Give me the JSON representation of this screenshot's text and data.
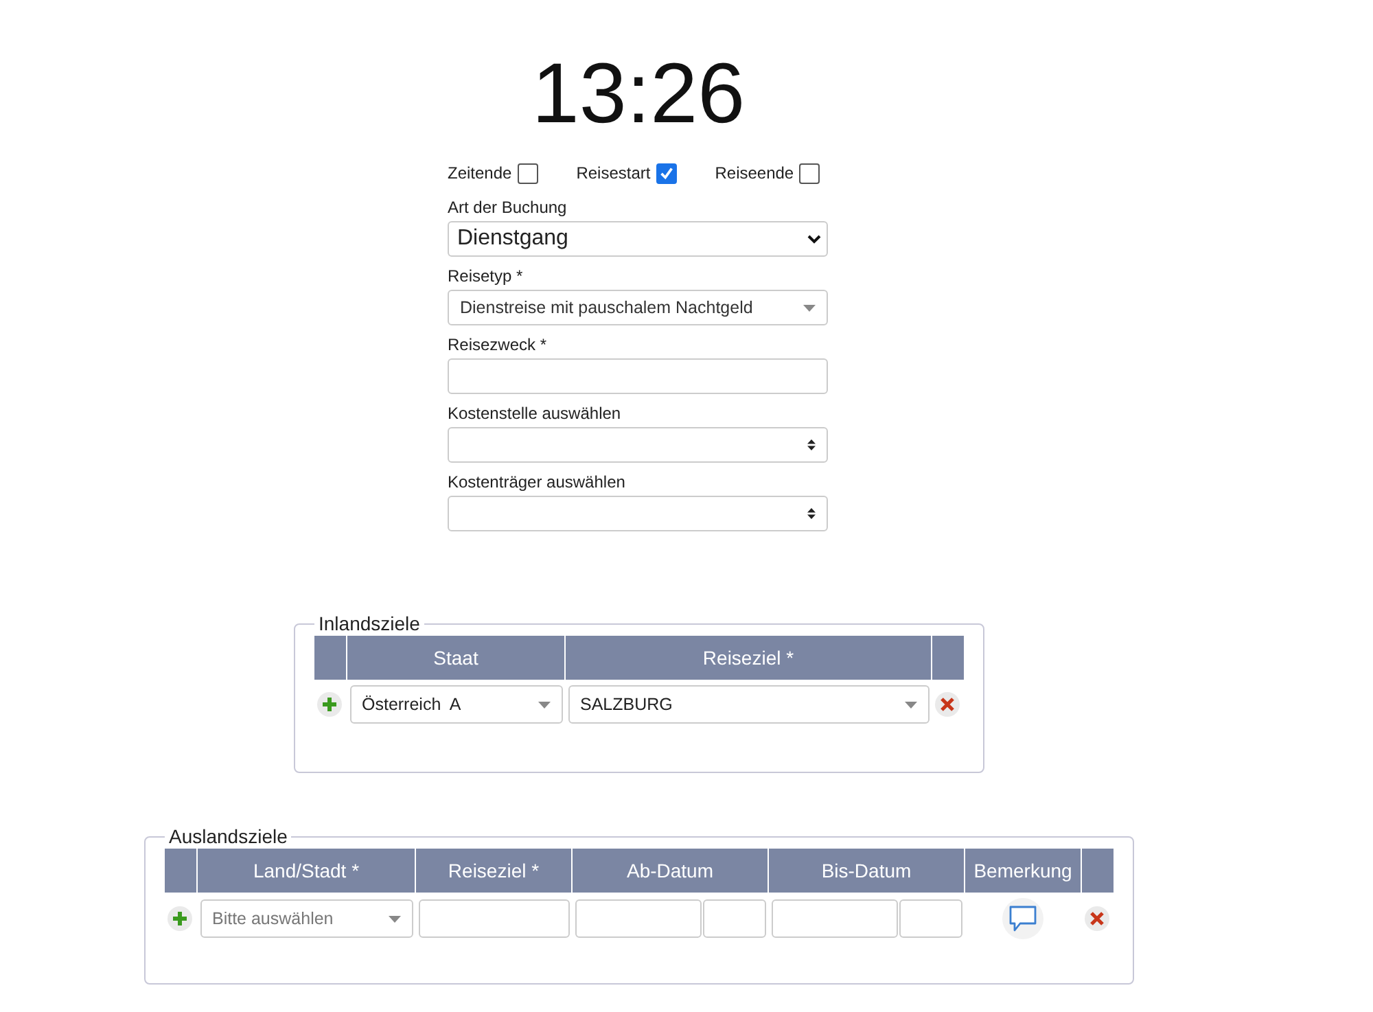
{
  "clock": "13:26",
  "checkboxes": [
    {
      "label": "Zeitende",
      "checked": false
    },
    {
      "label": "Reisestart",
      "checked": true
    },
    {
      "label": "Reiseende",
      "checked": false
    }
  ],
  "fields": [
    {
      "label": "Art der Buchung",
      "kind": "native-select",
      "value": "Dienstgang"
    },
    {
      "label": "Reisetyp *",
      "kind": "combo",
      "value": "Dienstreise mit pauschalem Nachtgeld"
    },
    {
      "label": "Reisezweck *",
      "kind": "text"
    },
    {
      "label": "Kostenstelle auswählen",
      "kind": "spin-select"
    },
    {
      "label": "Kostenträger auswählen",
      "kind": "spin-select"
    }
  ],
  "inland": {
    "legend": "Inlandsziele",
    "columns": [
      "Staat",
      "Reiseziel *"
    ],
    "rows": [
      {
        "staat": "Österreich  A",
        "reiseziel": "SALZBURG"
      }
    ]
  },
  "ausland": {
    "legend": "Auslandsziele",
    "columns": [
      "Land/Stadt *",
      "Reiseziel *",
      "Ab-Datum",
      "Bis-Datum",
      "Bemerkung"
    ],
    "rows": [
      {
        "land_placeholder": "Bitte auswählen"
      }
    ]
  }
}
